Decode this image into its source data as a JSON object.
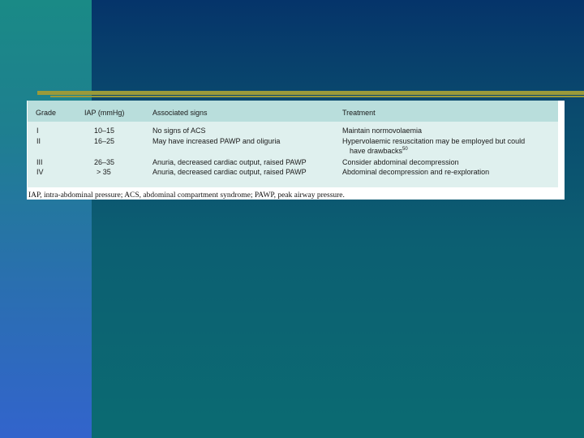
{
  "table": {
    "headers": {
      "grade": "Grade",
      "iap": "IAP (mmHg)",
      "signs": "Associated signs",
      "treatment": "Treatment"
    },
    "rows": [
      {
        "grade": "I",
        "iap": "10–15",
        "signs": "No signs of ACS",
        "treatment": "Maintain normovolaemia"
      },
      {
        "grade": "II",
        "iap": "16–25",
        "signs": "May have increased PAWP and oliguria",
        "treatment": "Hypervolaemic resuscitation may be employed but could",
        "treatment_cont": "have drawbacks",
        "treatment_ref": "50"
      },
      {
        "grade": "III",
        "iap": "26–35",
        "signs": "Anuria, decreased cardiac output, raised PAWP",
        "treatment": "Consider abdominal decompression"
      },
      {
        "grade": "IV",
        "iap": "> 35",
        "signs": "Anuria, decreased cardiac output, raised PAWP",
        "treatment": "Abdominal decompression and re-exploration"
      }
    ]
  },
  "footnote": "IAP, intra-abdominal pressure; ACS, abdominal compartment syndrome; PAWP, peak airway pressure."
}
